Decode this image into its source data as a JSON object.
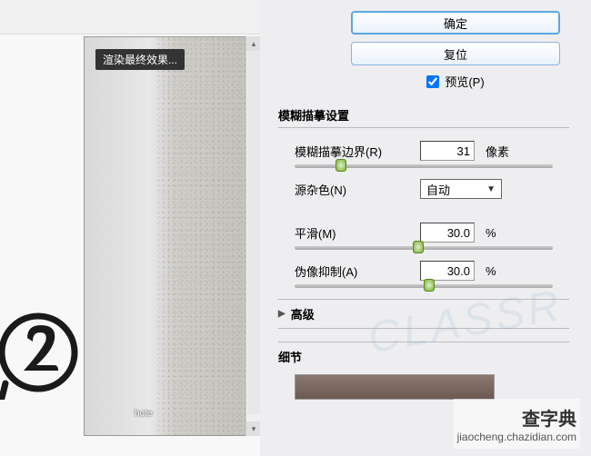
{
  "tooltip": "渲染最终效果...",
  "small_label": "hote",
  "buttons": {
    "ok": "确定",
    "reset": "复位"
  },
  "preview_check": {
    "label": "预览(P)",
    "checked": true
  },
  "sections": {
    "blur_mask": "模糊描摹设置",
    "advanced": "高级",
    "detail": "细节"
  },
  "fields": {
    "edge": {
      "label": "模糊描摹边界(R)",
      "value": "31",
      "unit": "像素",
      "pct": 18
    },
    "noise": {
      "label": "源杂色(N)",
      "value": "自动"
    },
    "smooth": {
      "label": "平滑(M)",
      "value": "30.0",
      "unit": "%",
      "pct": 48
    },
    "artifact": {
      "label": "伪像抑制(A)",
      "value": "30.0",
      "unit": "%",
      "pct": 52
    }
  },
  "watermark": {
    "line1": "查字典",
    "line2": "jiaocheng.chazidian.com",
    "bg": "CLASSR"
  }
}
